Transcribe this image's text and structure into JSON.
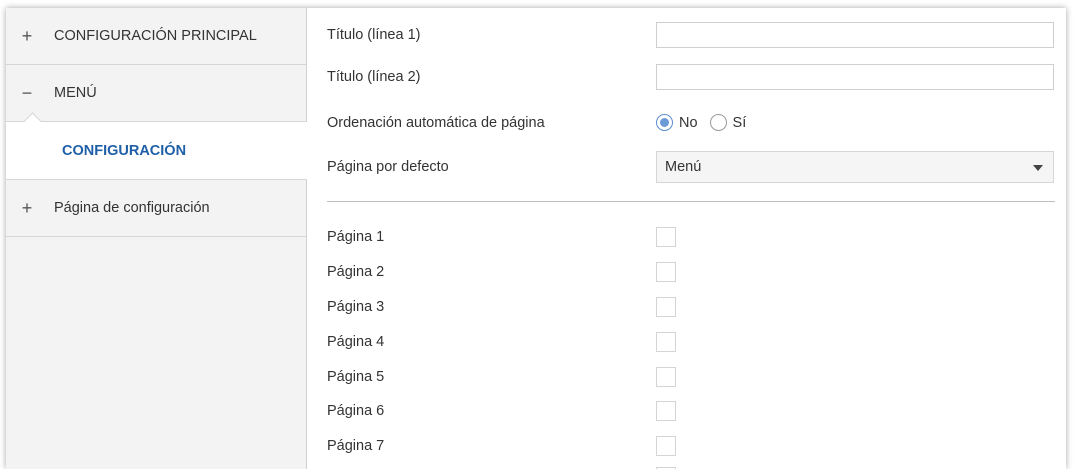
{
  "sidebar": {
    "items": [
      {
        "sign": "+",
        "label": "CONFIGURACIÓN PRINCIPAL"
      },
      {
        "sign": "−",
        "label": "MENÚ"
      },
      {
        "label": "CONFIGURACIÓN"
      },
      {
        "sign": "+",
        "label": "Página de configuración"
      }
    ]
  },
  "form": {
    "title1_label": "Título (línea 1)",
    "title1_value": "",
    "title2_label": "Título (línea 2)",
    "title2_value": "",
    "auto_order_label": "Ordenación automática de página",
    "auto_order_options": [
      "No",
      "Sí"
    ],
    "auto_order_selected": "No",
    "default_page_label": "Página por defecto",
    "default_page_value": "Menú"
  },
  "pages": [
    {
      "label": "Página 1",
      "checked": false
    },
    {
      "label": "Página 2",
      "checked": false
    },
    {
      "label": "Página 3",
      "checked": false
    },
    {
      "label": "Página 4",
      "checked": false
    },
    {
      "label": "Página 5",
      "checked": false
    },
    {
      "label": "Página 6",
      "checked": false
    },
    {
      "label": "Página 7",
      "checked": false
    }
  ],
  "colors": {
    "active_item": "#1f5fa8",
    "sidebar_bg": "#f3f3f3",
    "radio_selected": "#6b9ad6"
  }
}
